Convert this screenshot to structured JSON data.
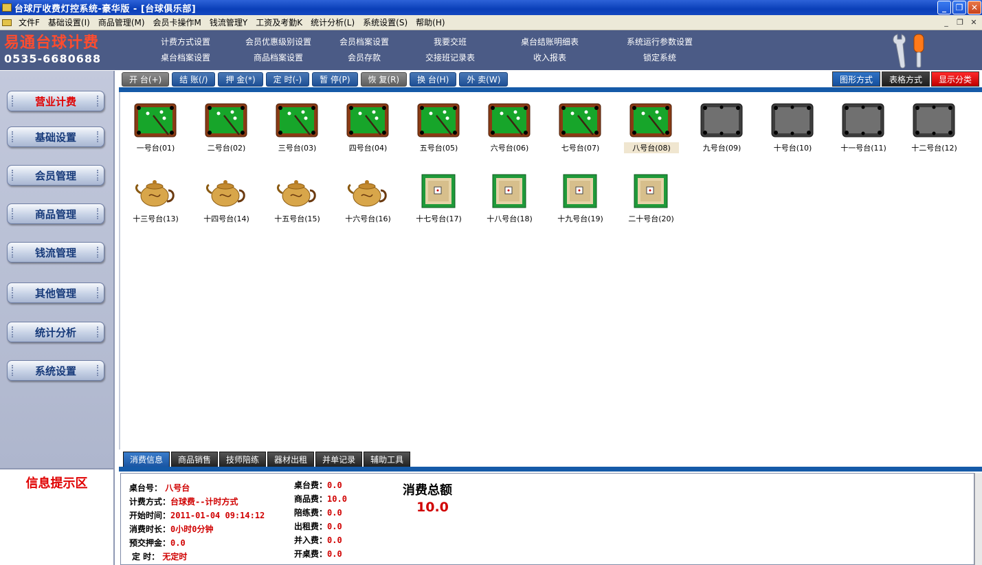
{
  "window": {
    "title": "台球厅收费灯控系统-豪华版 - [台球俱乐部]",
    "buttons": [
      "_",
      "❐",
      "✕"
    ]
  },
  "menu": {
    "items": [
      "文件F",
      "基础设置(I)",
      "商品管理(M)",
      "会员卡操作M",
      "钱流管理Y",
      "工资及考勤K",
      "统计分析(L)",
      "系统设置(S)",
      "帮助(H)"
    ],
    "mdi_buttons": [
      "_",
      "❐",
      "✕"
    ]
  },
  "brand": {
    "name": "易通台球计费",
    "phone": "0535-6680688"
  },
  "header_links": [
    "计费方式设置",
    "会员优惠级别设置",
    "会员档案设置",
    "我要交班",
    "桌台结账明细表",
    "系统运行参数设置",
    "桌台档案设置",
    "商品档案设置",
    "会员存款",
    "交接班记录表",
    "收入报表",
    "锁定系统"
  ],
  "toolbar": {
    "buttons": [
      {
        "label": "开 台(+)",
        "gray": true
      },
      {
        "label": "结 账(/)",
        "gray": false
      },
      {
        "label": "押 金(*)",
        "gray": false
      },
      {
        "label": "定 时(-)",
        "gray": false
      },
      {
        "label": "暂 停(P)",
        "gray": false
      },
      {
        "label": "恢 复(R)",
        "gray": true
      },
      {
        "label": "换 台(H)",
        "gray": false
      },
      {
        "label": "外 卖(W)",
        "gray": false
      }
    ],
    "view_buttons": [
      "图形方式",
      "表格方式",
      "显示分类"
    ]
  },
  "sidebar": {
    "items": [
      "营业计费",
      "基础设置",
      "会员管理",
      "商品管理",
      "钱流管理",
      "其他管理",
      "统计分析",
      "系统设置"
    ],
    "active_index": 0
  },
  "info_panel_title": "信息提示区",
  "tables": [
    {
      "label": "一号台(01)",
      "type": "billiard-active"
    },
    {
      "label": "二号台(02)",
      "type": "billiard-active"
    },
    {
      "label": "三号台(03)",
      "type": "billiard-active"
    },
    {
      "label": "四号台(04)",
      "type": "billiard-active"
    },
    {
      "label": "五号台(05)",
      "type": "billiard-active"
    },
    {
      "label": "六号台(06)",
      "type": "billiard-active"
    },
    {
      "label": "七号台(07)",
      "type": "billiard-active"
    },
    {
      "label": "八号台(08)",
      "type": "billiard-active",
      "selected": true
    },
    {
      "label": "九号台(09)",
      "type": "billiard-idle"
    },
    {
      "label": "十号台(10)",
      "type": "billiard-idle"
    },
    {
      "label": "十一号台(11)",
      "type": "billiard-idle"
    },
    {
      "label": "十二号台(12)",
      "type": "billiard-idle"
    },
    {
      "label": "十三号台(13)",
      "type": "teapot"
    },
    {
      "label": "十四号台(14)",
      "type": "teapot"
    },
    {
      "label": "十五号台(15)",
      "type": "teapot"
    },
    {
      "label": "十六号台(16)",
      "type": "teapot"
    },
    {
      "label": "十七号台(17)",
      "type": "mahjong"
    },
    {
      "label": "十八号台(18)",
      "type": "mahjong"
    },
    {
      "label": "十九号台(19)",
      "type": "mahjong"
    },
    {
      "label": "二十号台(20)",
      "type": "mahjong"
    }
  ],
  "bottom_tabs": [
    "消费信息",
    "商品销售",
    "技师陪练",
    "器材出租",
    "并单记录",
    "辅助工具"
  ],
  "consumption": {
    "left": [
      {
        "label": "桌台号：",
        "value": "八号台"
      },
      {
        "label": "计费方式：",
        "value": "台球费--计时方式"
      },
      {
        "label": "开始时间：",
        "value": "2011-01-04 09:14:12"
      },
      {
        "label": "消费时长：",
        "value": "0小时0分钟"
      },
      {
        "label": "预交押金：",
        "value": "0.0"
      },
      {
        "label": "定  时：",
        "value": "无定时"
      }
    ],
    "fees": [
      {
        "label": "桌台费：",
        "value": "0.0"
      },
      {
        "label": "商品费：",
        "value": "10.0"
      },
      {
        "label": "陪练费：",
        "value": "0.0"
      },
      {
        "label": "出租费：",
        "value": "0.0"
      },
      {
        "label": "并入费：",
        "value": "0.0"
      },
      {
        "label": "开桌费：",
        "value": "0.0"
      }
    ],
    "total_label": "消费总额",
    "total_value": "10.0"
  }
}
